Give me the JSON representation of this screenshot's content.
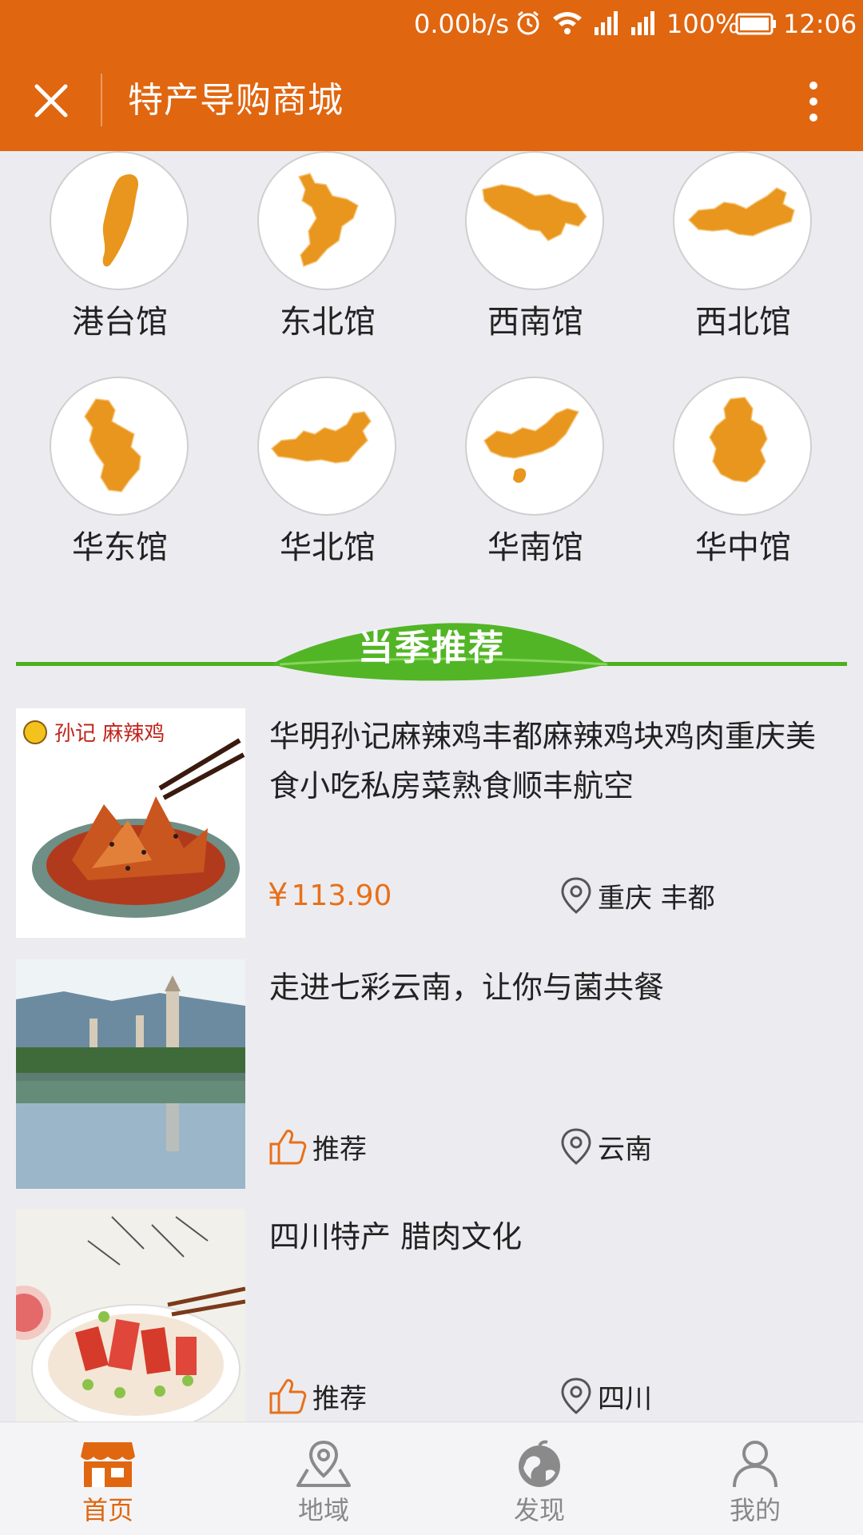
{
  "statusbar": {
    "net_speed": "0.00b/s",
    "battery": "100%",
    "time": "12:06",
    "icons": [
      "alarm-icon",
      "wifi-icon",
      "signal-icon",
      "signal-icon",
      "battery-icon"
    ]
  },
  "header": {
    "title": "特产导购商城",
    "close_icon": "close-icon",
    "more_icon": "more-vertical-icon",
    "background": "#e06610"
  },
  "regions": [
    {
      "label": "港台馆",
      "icon": "taiwan-map-icon"
    },
    {
      "label": "东北馆",
      "icon": "northeast-map-icon"
    },
    {
      "label": "西南馆",
      "icon": "southwest-map-icon"
    },
    {
      "label": "西北馆",
      "icon": "northwest-map-icon"
    },
    {
      "label": "华东馆",
      "icon": "east-china-map-icon"
    },
    {
      "label": "华北馆",
      "icon": "north-china-map-icon"
    },
    {
      "label": "华南馆",
      "icon": "south-china-map-icon"
    },
    {
      "label": "华中馆",
      "icon": "central-china-map-icon"
    }
  ],
  "season_banner": {
    "title": "当季推荐",
    "color": "#4caf1f"
  },
  "products": [
    {
      "title": "华明孙记麻辣鸡丰都麻辣鸡块鸡肉重庆美食小吃私房菜熟食顺丰航空",
      "price": "113.90",
      "price_symbol": "¥",
      "location": "重庆 丰都",
      "image": "spicy-chicken-photo",
      "brand_text": "孙记 麻辣鸡"
    },
    {
      "title": "走进七彩云南，让你与菌共餐",
      "tag": "推荐",
      "location": "云南",
      "image": "yunnan-pagoda-lake-photo"
    },
    {
      "title": "四川特产 腊肉文化",
      "tag": "推荐",
      "location": "四川",
      "image": "sichuan-cured-meat-dish-photo"
    }
  ],
  "bottom_nav": [
    {
      "label": "首页",
      "icon": "shop-icon",
      "active": true
    },
    {
      "label": "地域",
      "icon": "map-pin-icon",
      "active": false
    },
    {
      "label": "发现",
      "icon": "globe-icon",
      "active": false
    },
    {
      "label": "我的",
      "icon": "user-icon",
      "active": false
    }
  ],
  "colors": {
    "accent": "#e06610",
    "price": "#e8701a",
    "map_fill": "#e8961e",
    "leaf_green": "#4caf1f"
  }
}
